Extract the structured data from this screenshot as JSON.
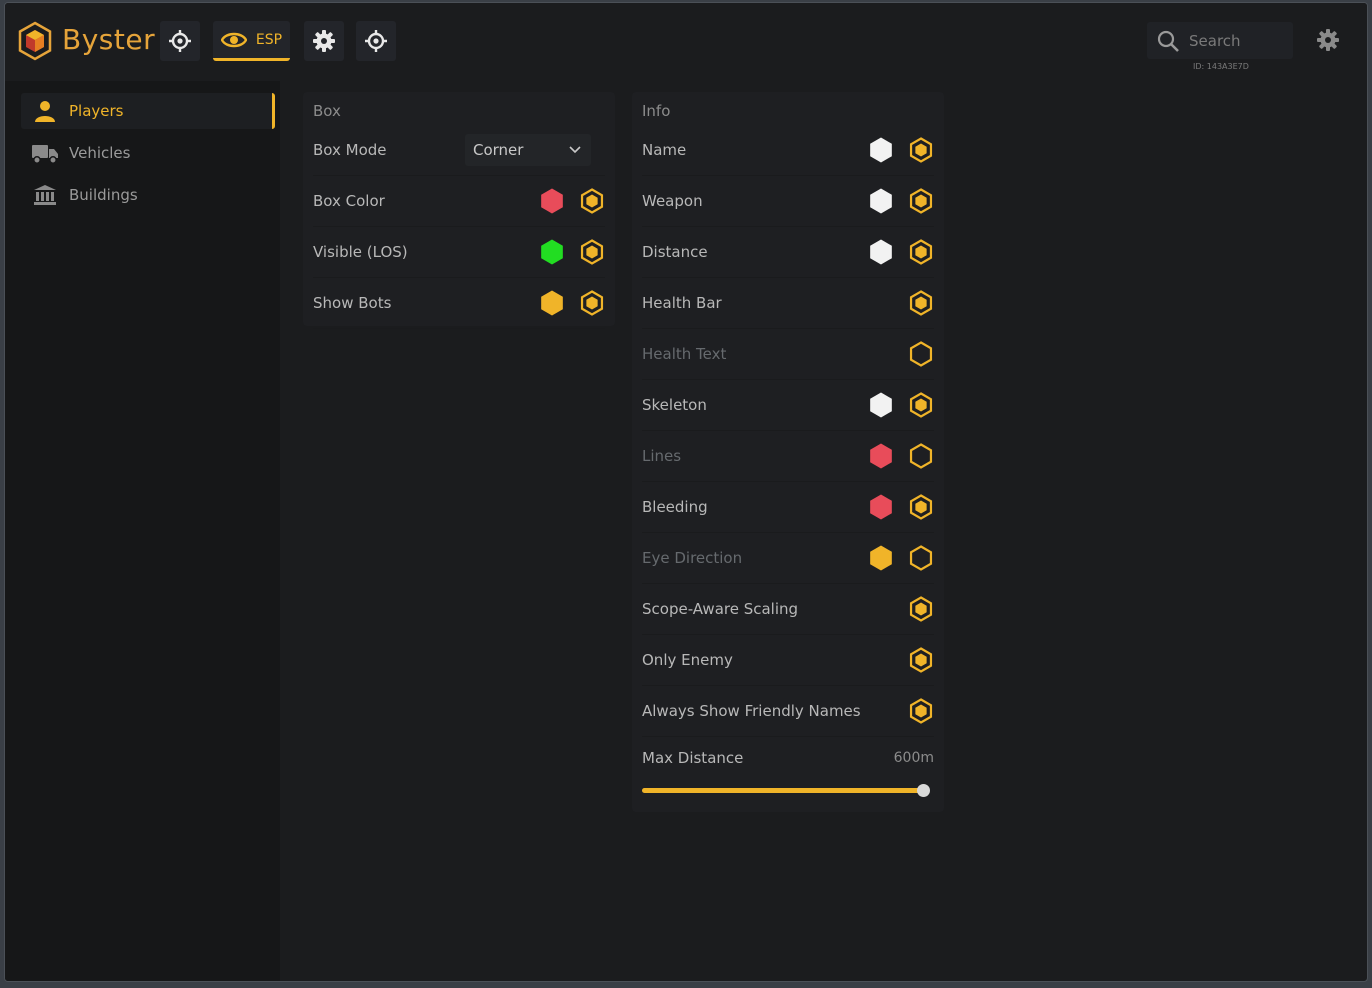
{
  "brand": {
    "name": "Byster"
  },
  "topbar": {
    "esp_label": "ESP",
    "search_placeholder": "Search",
    "user_id": "ID: 143A3E7D"
  },
  "sidebar": {
    "items": [
      {
        "label": "Players",
        "icon": "person-icon",
        "active": true
      },
      {
        "label": "Vehicles",
        "icon": "truck-icon",
        "active": false
      },
      {
        "label": "Buildings",
        "icon": "building-icon",
        "active": false
      }
    ]
  },
  "box_panel": {
    "title": "Box",
    "box_mode": {
      "label": "Box Mode",
      "value": "Corner"
    },
    "rows": [
      {
        "label": "Box Color",
        "color": "#e84c5a",
        "enabled": true
      },
      {
        "label": "Visible (LOS)",
        "color": "#22dd22",
        "enabled": true
      },
      {
        "label": "Show Bots",
        "color": "#f0b429",
        "enabled": true
      }
    ]
  },
  "info_panel": {
    "title": "Info",
    "rows": [
      {
        "label": "Name",
        "color": "#f2f2f2",
        "enabled": true
      },
      {
        "label": "Weapon",
        "color": "#f2f2f2",
        "enabled": true
      },
      {
        "label": "Distance",
        "color": "#f2f2f2",
        "enabled": true
      },
      {
        "label": "Health Bar",
        "color": null,
        "enabled": true
      },
      {
        "label": "Health Text",
        "color": null,
        "enabled": false
      },
      {
        "label": "Skeleton",
        "color": "#f2f2f2",
        "enabled": true
      },
      {
        "label": "Lines",
        "color": "#e84c5a",
        "enabled": false
      },
      {
        "label": "Bleeding",
        "color": "#e84c5a",
        "enabled": true
      },
      {
        "label": "Eye Direction",
        "color": "#f0b429",
        "enabled": false
      },
      {
        "label": "Scope-Aware Scaling",
        "color": null,
        "enabled": true
      },
      {
        "label": "Only Enemy",
        "color": null,
        "enabled": true
      },
      {
        "label": "Always Show Friendly Names",
        "color": null,
        "enabled": true
      }
    ],
    "max_distance": {
      "label": "Max Distance",
      "value_text": "600m",
      "fraction": 1.0
    }
  },
  "colors": {
    "accent": "#f0b429",
    "background": "#1b1c1e",
    "panel": "#1e1f22"
  }
}
